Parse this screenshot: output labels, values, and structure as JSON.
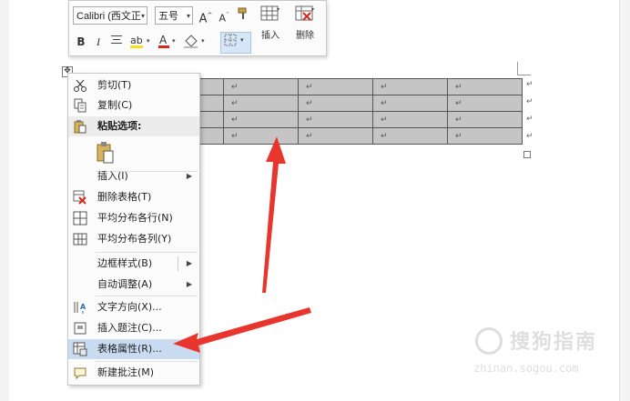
{
  "toolbar": {
    "font_name": "Calibri (西文正",
    "font_size": "五号",
    "bold": "B",
    "italic": "I",
    "grow_font": "A",
    "shrink_font": "A",
    "font_color_letter": "A",
    "insert_label": "插入",
    "delete_label": "删除"
  },
  "context_menu": {
    "cut": "剪切(T)",
    "copy": "复制(C)",
    "paste_options": "粘贴选项:",
    "insert": "插入(I)",
    "delete_table": "删除表格(T)",
    "distribute_rows": "平均分布各行(N)",
    "distribute_columns": "平均分布各列(Y)",
    "border_styles": "边框样式(B)",
    "autofit": "自动调整(A)",
    "text_direction": "文字方向(X)...",
    "insert_caption": "插入题注(C)...",
    "table_properties": "表格属性(R)...",
    "new_comment": "新建批注(M)"
  },
  "table": {
    "cell_mark": "↵",
    "rows": 4,
    "cols": 6
  },
  "watermark": {
    "text": "搜狗指南",
    "url": "zhinan.sogou.com"
  },
  "colors": {
    "highlight": "#c9dbf0",
    "arrow": "#e8362e",
    "cell_fill": "#c5c5c5",
    "font_red": "#d9261c",
    "highlighter_yellow": "#f5e21b"
  }
}
